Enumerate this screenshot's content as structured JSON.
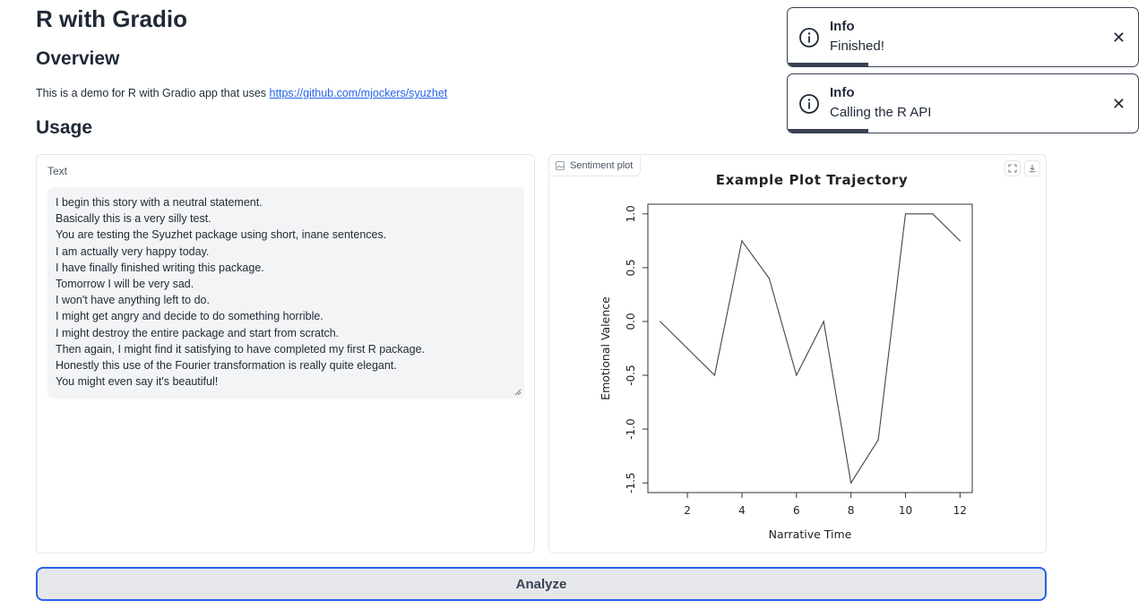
{
  "page": {
    "title": "R with Gradio",
    "overview_heading": "Overview",
    "description": "This is a demo for R with Gradio app that uses",
    "link_text": "https://github.com/mjockers/syuzhet",
    "usage_heading": "Usage"
  },
  "textbox": {
    "label": "Text",
    "lines": [
      "I begin this story with a neutral statement.",
      "Basically this is a very silly test.",
      "You are testing the Syuzhet package using short, inane sentences.",
      "I am actually very happy today.",
      "I have finally finished writing this package.",
      "Tomorrow I will be very sad.",
      "I won't have anything left to do.",
      "I might get angry and decide to do something horrible.",
      "I might destroy the entire package and start from scratch.",
      "Then again, I might find it satisfying to have completed my first R package.",
      "Honestly this use of the Fourier transformation is really quite elegant.",
      "You might even say it's beautiful!"
    ]
  },
  "plot": {
    "label": "Sentiment plot",
    "icons": [
      "image-icon",
      "fullscreen-icon",
      "download-icon"
    ]
  },
  "analyze_button": {
    "label": "Analyze"
  },
  "toasts": [
    {
      "title": "Info",
      "message": "Finished!",
      "icon": "info-icon",
      "progress": 0.23
    },
    {
      "title": "Info",
      "message": "Calling the R API",
      "icon": "info-icon",
      "progress": 0.23
    }
  ],
  "colors": {
    "accent": "#2563eb",
    "toast_border": "#374151",
    "textarea_bg": "#f3f4f6"
  },
  "chart_data": {
    "type": "line",
    "title": "Example Plot Trajectory",
    "xlabel": "Narrative Time",
    "ylabel": "Emotional Valence",
    "x": [
      1,
      2,
      3,
      4,
      5,
      6,
      7,
      8,
      9,
      10,
      11,
      12
    ],
    "values": [
      0.0,
      -0.25,
      -0.5,
      0.75,
      0.4,
      -0.5,
      0.0,
      -1.5,
      -1.1,
      1.0,
      1.0,
      0.75
    ],
    "xticks": [
      "2",
      "4",
      "6",
      "8",
      "10",
      "12"
    ],
    "yticks": [
      "-1.5",
      "-1.0",
      "-0.5",
      "0.0",
      "0.5",
      "1.0"
    ],
    "xlim": [
      0.55,
      12.45
    ],
    "ylim": [
      -1.59,
      1.09
    ],
    "grid": false
  }
}
